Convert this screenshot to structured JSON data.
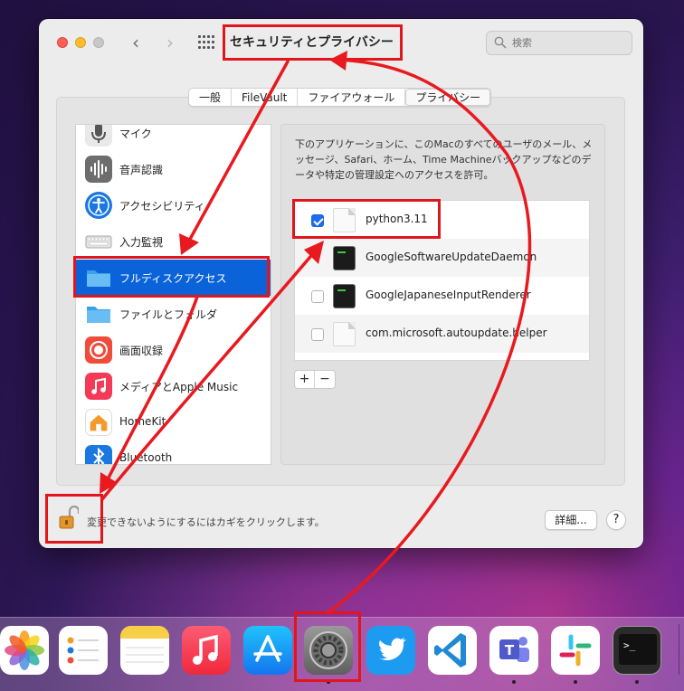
{
  "window": {
    "title": "セキュリティとプライバシー",
    "search_placeholder": "検索"
  },
  "tabs": [
    "一般",
    "FileVault",
    "ファイアウォール",
    "プライバシー"
  ],
  "selected_tab": "プライバシー",
  "sidebar": {
    "items": [
      {
        "label": "マイク",
        "icon": "microphone-icon"
      },
      {
        "label": "音声認識",
        "icon": "speech-recognition-icon"
      },
      {
        "label": "アクセシビリティ",
        "icon": "accessibility-icon"
      },
      {
        "label": "入力監視",
        "icon": "keyboard-icon"
      },
      {
        "label": "フルディスクアクセス",
        "icon": "folder-icon",
        "selected": true
      },
      {
        "label": "ファイルとフォルダ",
        "icon": "folder-icon"
      },
      {
        "label": "画面収録",
        "icon": "screen-recording-icon"
      },
      {
        "label": "メディアとApple Music",
        "icon": "music-icon"
      },
      {
        "label": "HomeKit",
        "icon": "home-icon"
      },
      {
        "label": "Bluetooth",
        "icon": "bluetooth-icon"
      }
    ]
  },
  "detail": {
    "description": "下のアプリケーションに、このMacのすべてのユーザのメール、メッセージ、Safari、ホーム、Time Machineバックアップなどのデータや特定の管理設定へのアクセスを許可。",
    "apps": [
      {
        "name": "python3.11",
        "checked": true,
        "icon": "document-icon"
      },
      {
        "name": "GoogleSoftwareUpdateDaemon",
        "checked": false,
        "icon": "terminal-exec-icon"
      },
      {
        "name": "GoogleJapaneseInputRenderer",
        "checked": false,
        "icon": "terminal-exec-icon"
      },
      {
        "name": "com.microsoft.autoupdate.helper",
        "checked": false,
        "icon": "document-icon"
      }
    ],
    "add_label": "+",
    "remove_label": "−"
  },
  "footer": {
    "lock_text": "変更できないようにするにはカギをクリックします。",
    "details_label": "詳細...",
    "help_label": "?"
  },
  "dock": {
    "apps": [
      "Photos",
      "Reminders",
      "Notes",
      "Music",
      "App Store",
      "System Preferences",
      "Twitter",
      "Visual Studio Code",
      "Microsoft Teams",
      "Slack",
      "Terminal"
    ]
  },
  "colors": {
    "selection": "#0a63d8",
    "annotation": "#e0161c",
    "checkbox_on": "#1e6cf0"
  }
}
